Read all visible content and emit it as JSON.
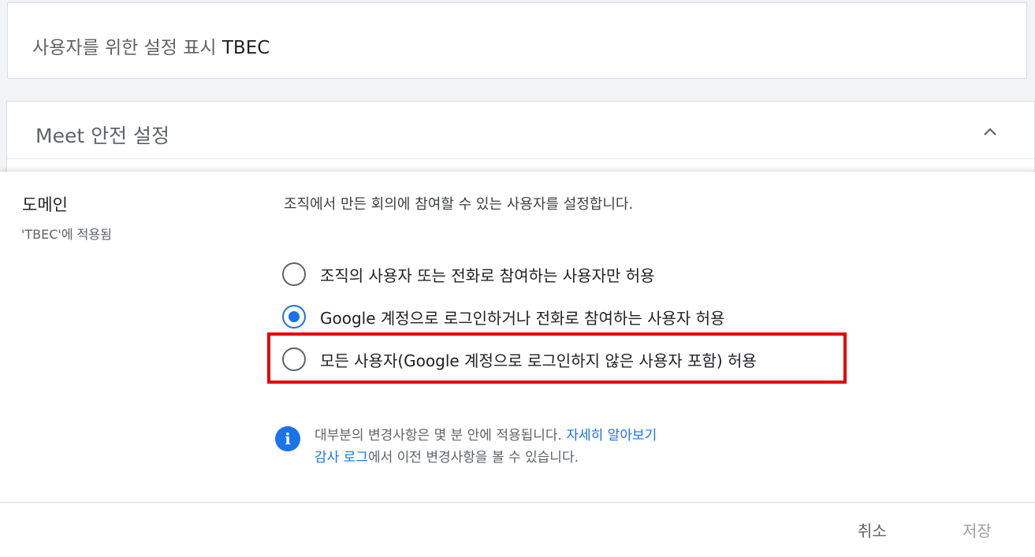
{
  "header_card": {
    "prefix": "사용자를 위한 설정 표시",
    "org": "TBEC"
  },
  "section": {
    "title": "Meet 안전 설정",
    "collapse_icon": "chevron-up-icon"
  },
  "setting": {
    "name": "도메인",
    "scope": "'TBEC'에 적용됨",
    "description": "조직에서 만든 회의에 참여할 수 있는 사용자를 설정합니다.",
    "options": [
      {
        "label": "조직의 사용자 또는 전화로 참여하는 사용자만 허용",
        "selected": false
      },
      {
        "label": "Google 계정으로 로그인하거나 전화로 참여하는 사용자 허용",
        "selected": true
      },
      {
        "label": "모든 사용자(Google 계정으로 로그인하지 않은 사용자 포함) 허용",
        "selected": false
      }
    ]
  },
  "info": {
    "icon": "info-icon",
    "line1_text": "대부분의 변경사항은 몇 분 안에 적용됩니다.",
    "line1_link": "자세히 알아보기",
    "line2_link": "감사 로그",
    "line2_text": "에서 이전 변경사항을 볼 수 있습니다."
  },
  "actions": {
    "cancel": "취소",
    "save": "저장"
  },
  "colors": {
    "accent": "#1a73e8",
    "highlight": "#e60000"
  }
}
